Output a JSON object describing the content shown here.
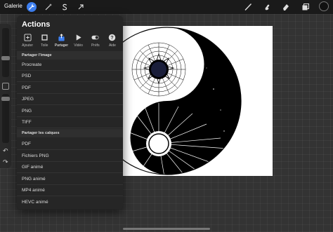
{
  "topbar": {
    "gallery_label": "Galerie",
    "icons": [
      "wrench-icon",
      "magic-wand-icon",
      "selection-s-icon",
      "transform-arrow-icon",
      "brush-icon",
      "smudge-icon",
      "eraser-icon",
      "layers-icon",
      "color-icon"
    ]
  },
  "panel": {
    "title": "Actions",
    "tabs": [
      {
        "label": "Ajouter",
        "icon": "add-icon"
      },
      {
        "label": "Toile",
        "icon": "canvas-icon"
      },
      {
        "label": "Partager",
        "icon": "share-icon"
      },
      {
        "label": "Vidéo",
        "icon": "video-play-icon"
      },
      {
        "label": "Préfs",
        "icon": "toggle-icon"
      },
      {
        "label": "Aide",
        "icon": "help-icon"
      }
    ],
    "active_tab": "Partager",
    "share_image_header": "Partager l'image",
    "share_image_items": [
      "Procreate",
      "PSD",
      "PDF",
      "JPEG",
      "PNG",
      "TIFF"
    ],
    "share_layers_header": "Partager les calques",
    "share_layers_items": [
      "PDF",
      "Fichiers PNG",
      "GIF animé",
      "PNG animé",
      "MP4 animé",
      "HEVC animé"
    ]
  },
  "colors": {
    "accent": "#3d7ff0",
    "panel_bg": "#262626",
    "toolbar_bg": "#1a1a1a"
  }
}
